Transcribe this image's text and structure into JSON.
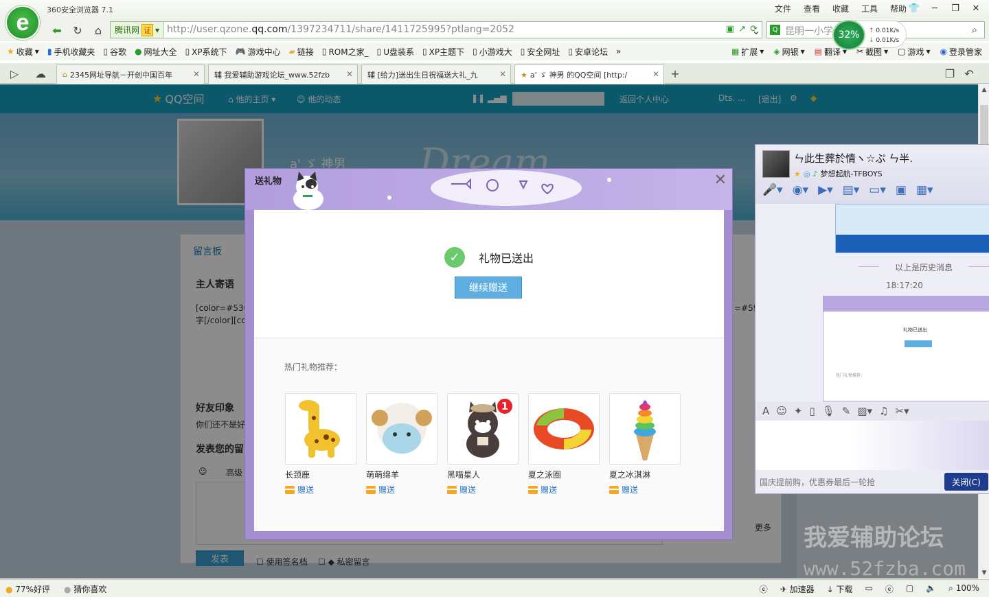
{
  "browser": {
    "app_title": "360安全浏览器 7.1",
    "menu": [
      "文件",
      "查看",
      "收藏",
      "工具",
      "帮助"
    ],
    "cert_label": "腾讯网",
    "cert_badge": "证",
    "url_gray_prefix": "http://user.qzone.",
    "url_domain": "qq.com",
    "url_rest": "/1397234711/share/1411725995?ptlang=2052",
    "search_placeholder": "昆明一小学",
    "speed_percent": "32%",
    "speed_up": "0.01K/s",
    "speed_down": "0.01K/s",
    "bookmarks": [
      "收藏",
      "手机收藏夹",
      "谷歌",
      "网址大全",
      "XP系统下",
      "游戏中心",
      "链接",
      "ROM之家_",
      "U盘装系",
      "XP主题下",
      "小游戏大",
      "安全网址",
      "安卓论坛"
    ],
    "bookmarks_right": [
      "扩展",
      "网银",
      "翻译",
      "截图",
      "游戏",
      "登录管家"
    ],
    "tabs": [
      {
        "label": "2345网址导航－开创中国百年"
      },
      {
        "label": "辅 我爱辅助游戏论坛_www.52fzb"
      },
      {
        "label": "辅 [给力]送出生日祝福送大礼_九"
      },
      {
        "label": "a' ゞ 神男 的QQ空间 [http:/"
      }
    ]
  },
  "qzone": {
    "logo_text": "QQ空间",
    "nav_home": "他的主页",
    "nav_feed": "他的动态",
    "nav_back": "返回个人中心",
    "nav_user": "Dts. ...",
    "nav_logout": "[退出]",
    "banner_text": "Dream",
    "profile_name": "a' ゞ 神男",
    "board_title": "留言板",
    "host_words": "主人寄语",
    "code_line1": "[color=#53C",
    "code_line2": "字[/color][co",
    "code_right": "=#597",
    "friends_title": "好友印象",
    "friends_sub": "你们还不是好",
    "post_title": "发表您的留",
    "advanced": "高级",
    "post_btn": "发表",
    "use_signature": "使用签名档",
    "private_msg": "私密留言",
    "more": "更多"
  },
  "dialog": {
    "title": "送礼物",
    "success_text": "礼物已送出",
    "continue_label": "继续赠送",
    "hot_title": "热门礼物推荐：",
    "gifts": [
      {
        "name": "长颈鹿",
        "send": "赠送"
      },
      {
        "name": "萌萌绵羊",
        "send": "赠送"
      },
      {
        "name": "黑喵星人",
        "send": "赠送",
        "badge": "1"
      },
      {
        "name": "夏之泳圈",
        "send": "赠送"
      },
      {
        "name": "夏之冰淇淋",
        "send": "赠送"
      }
    ]
  },
  "chat": {
    "name": "ㄣ此生葬於情ヽ☆ぷ ㄣ半.",
    "music": "梦想起航-TFBOYS",
    "history_label": "以上是历史消息",
    "time": "18:17:20",
    "mini_success": "礼物已送出",
    "mini_hot": "热门礼物推荐：",
    "ad_text": "国庆提前购，优惠券最后一轮抢",
    "close_label": "关闭(C)"
  },
  "statusbar": {
    "rating": "77%好评",
    "guess": "猜你喜欢",
    "accelerator": "加速器",
    "download": "下载",
    "zoom": "100%"
  },
  "watermark": {
    "line1": "我爱辅助论坛",
    "line2": "www.52fzba.com"
  },
  "colors": {
    "qzone_bar": "#16a1c4",
    "dialog_purple": "#a58fd0",
    "button_blue": "#5faee2",
    "success_green": "#6cc96c",
    "badge_red": "#e8232a"
  }
}
